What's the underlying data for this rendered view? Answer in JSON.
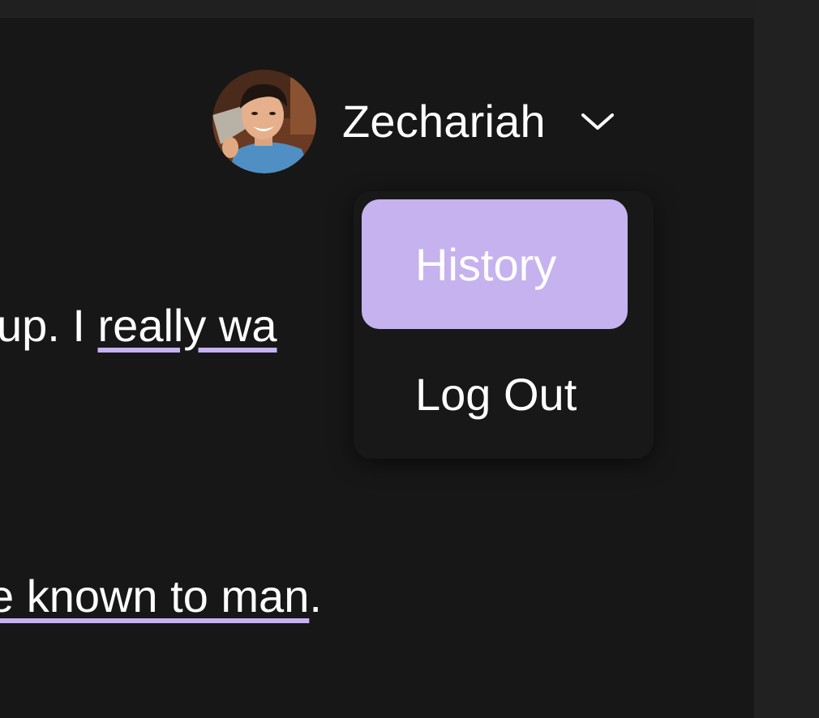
{
  "user": {
    "name": "Zechariah",
    "avatar_icon": "user-avatar-photo"
  },
  "menu": {
    "items": [
      {
        "label": "History",
        "state": "highlighted"
      },
      {
        "label": "Log Out",
        "state": "normal"
      }
    ],
    "chevron_icon": "chevron-down-icon"
  },
  "content": {
    "line1": {
      "before": "up. I ",
      "highlight": "really wa"
    },
    "line2": {
      "highlight": "e known to man",
      "after": "."
    }
  },
  "colors": {
    "background": "#171717",
    "accent": "#c6b2ee",
    "text": "#ffffff",
    "gutter": "#212121"
  }
}
